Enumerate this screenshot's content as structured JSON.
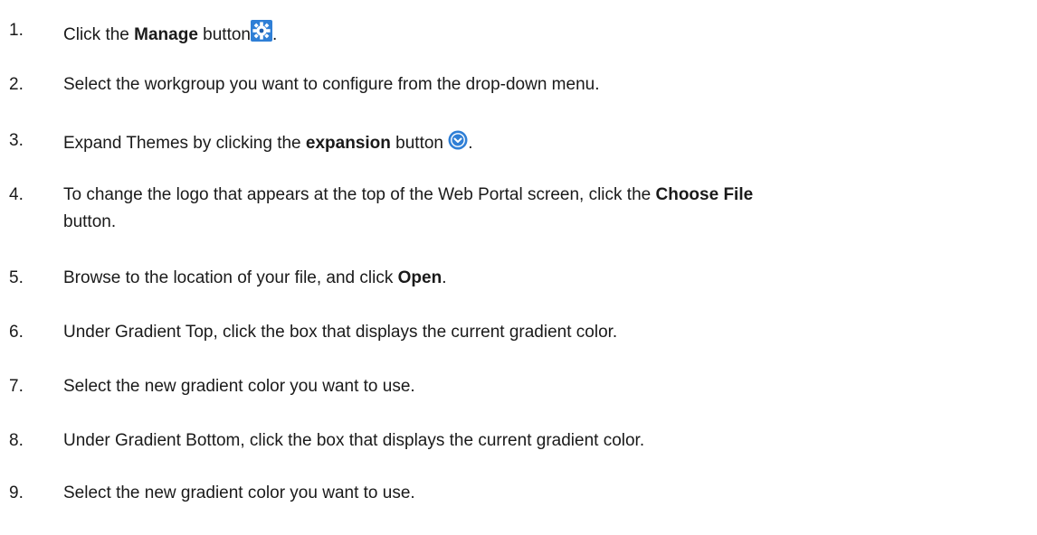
{
  "steps": [
    {
      "number": "1.",
      "before": "Click the ",
      "bold": "Manage",
      "after": " button",
      "icon": "manage-gear-icon",
      "end": "."
    },
    {
      "number": "2.",
      "text": "Select the workgroup you want to configure from the drop-down menu."
    },
    {
      "number": "3.",
      "before": "Expand Themes by clicking the ",
      "bold": "expansion",
      "after": " button ",
      "icon": "expand-chevron-icon",
      "end": "."
    },
    {
      "number": "4.",
      "before": "To change the logo that appears at the top of the Web Portal screen, click the ",
      "bold": "Choose File",
      "after": " button."
    },
    {
      "number": "5.",
      "before": "Browse to the location of your file, and click ",
      "bold": "Open",
      "after": "."
    },
    {
      "number": "6.",
      "text": "Under Gradient Top, click the box that displays the current gradient color."
    },
    {
      "number": "7.",
      "text": "Select the new gradient color you want to use."
    },
    {
      "number": "8.",
      "text": "Under Gradient Bottom, click the box that displays the current gradient color."
    },
    {
      "number": "9.",
      "text": "Select the new gradient color you want to use."
    }
  ],
  "colors": {
    "icon_blue": "#2f7fd6",
    "icon_dark_blue": "#1f5fae"
  }
}
